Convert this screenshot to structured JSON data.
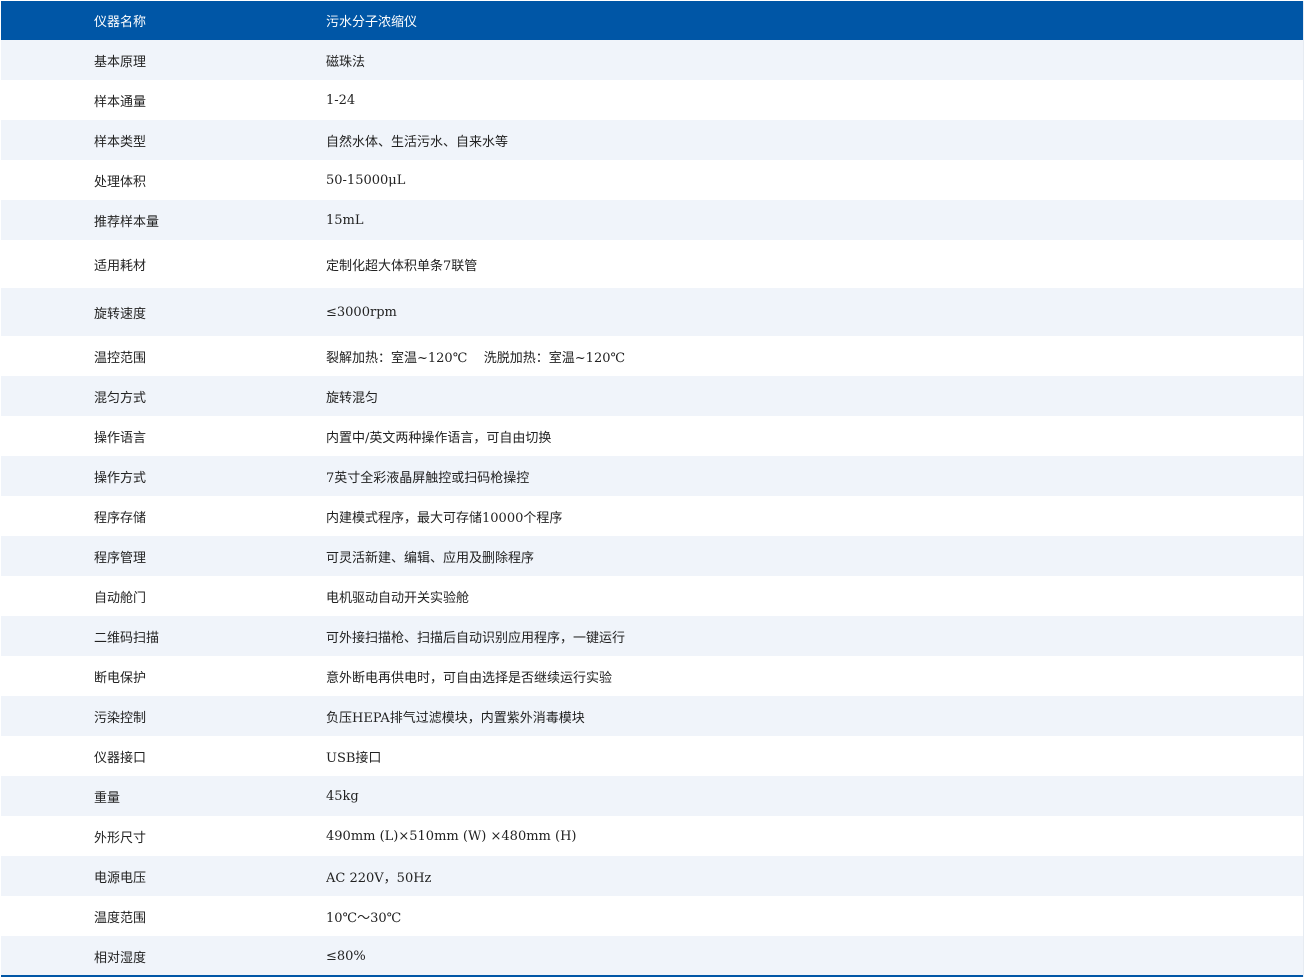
{
  "header": {
    "name": "仪器名称",
    "value": "污水分子浓缩仪"
  },
  "rows": [
    {
      "name": "基本原理",
      "value": "磁珠法"
    },
    {
      "name": "样本通量",
      "value": "1-24"
    },
    {
      "name": "样本类型",
      "value": "自然水体、生活污水、自来水等"
    },
    {
      "name": "处理体积",
      "value": "50-15000μL"
    },
    {
      "name": "推荐样本量",
      "value": "15mL"
    },
    {
      "name": "适用耗材",
      "value": "定制化超大体积单条7联管"
    },
    {
      "name": "旋转速度",
      "value": "≤3000rpm"
    },
    {
      "name": "温控范围",
      "value": "裂解加热：室温~120℃    洗脱加热：室温~120℃"
    },
    {
      "name": "混匀方式",
      "value": "旋转混匀"
    },
    {
      "name": "操作语言",
      "value": "内置中/英文两种操作语言，可自由切换"
    },
    {
      "name": "操作方式",
      "value": "7英寸全彩液晶屏触控或扫码枪操控"
    },
    {
      "name": "程序存储",
      "value": "内建模式程序，最大可存储10000个程序"
    },
    {
      "name": "程序管理",
      "value": "可灵活新建、编辑、应用及删除程序"
    },
    {
      "name": "自动舱门",
      "value": "电机驱动自动开关实验舱"
    },
    {
      "name": "二维码扫描",
      "value": "可外接扫描枪、扫描后自动识别应用程序，一键运行"
    },
    {
      "name": "断电保护",
      "value": "意外断电再供电时，可自由选择是否继续运行实验"
    },
    {
      "name": "污染控制",
      "value": "负压HEPA排气过滤模块，内置紫外消毒模块"
    },
    {
      "name": "仪器接口",
      "value": "USB接口"
    },
    {
      "name": "重量",
      "value": "45kg"
    },
    {
      "name": "外形尺寸",
      "value": "490mm (L)×510mm (W) ×480mm (H)"
    },
    {
      "name": "电源电压",
      "value": "AC 220V，50Hz"
    },
    {
      "name": "温度范围",
      "value": "10℃～30℃"
    },
    {
      "name": "相对湿度",
      "value": "≤80%"
    }
  ],
  "colors": {
    "header_bg": "#0056a6",
    "stripe_bg": "#f0f4fa"
  }
}
